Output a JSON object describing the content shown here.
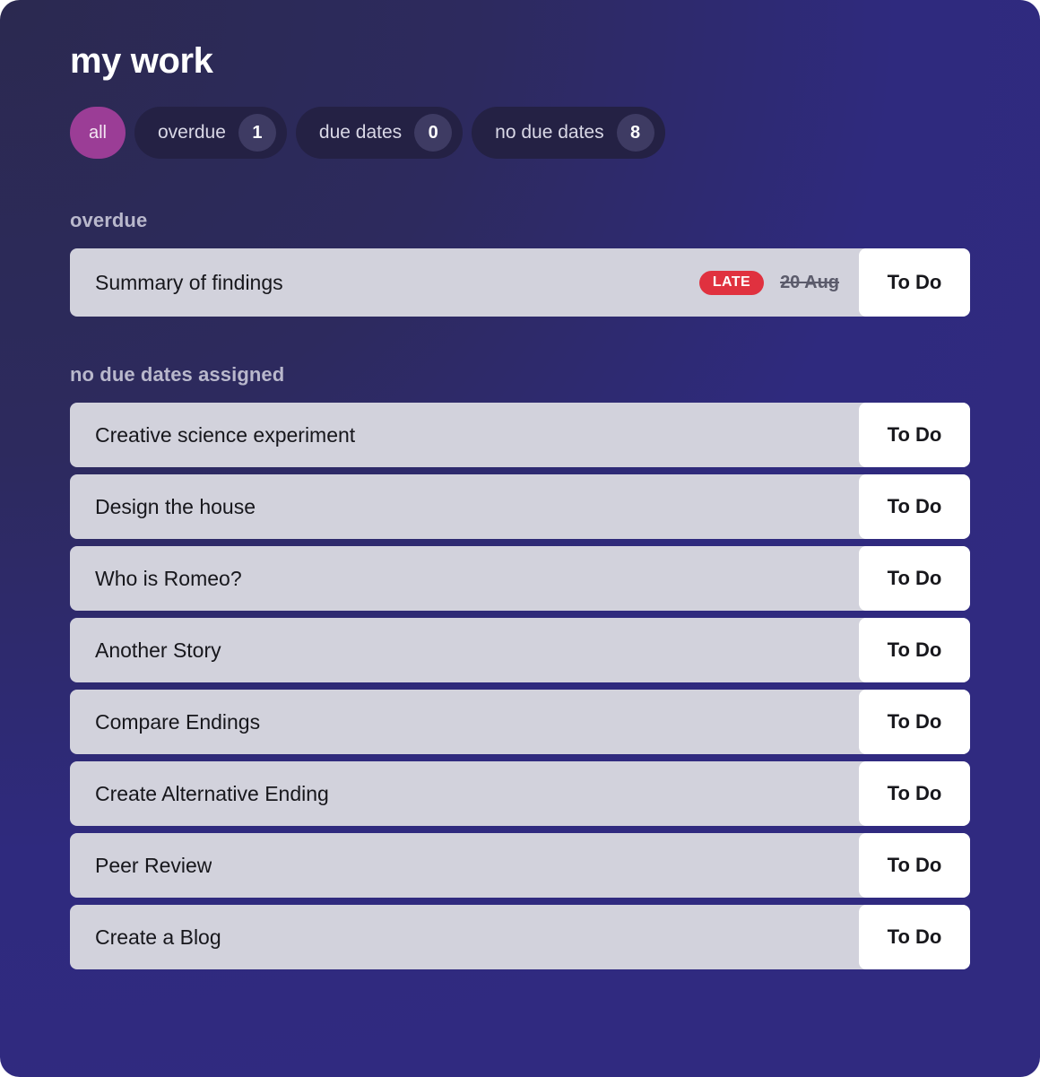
{
  "header": {
    "title": "my work"
  },
  "filters": [
    {
      "label": "all",
      "count": null,
      "active": true,
      "type": "all"
    },
    {
      "label": "overdue",
      "count": "1",
      "active": false,
      "type": "count"
    },
    {
      "label": "due dates",
      "count": "0",
      "active": false,
      "type": "count"
    },
    {
      "label": "no due dates",
      "count": "8",
      "active": false,
      "type": "count"
    }
  ],
  "sections": {
    "overdue": {
      "heading": "overdue",
      "tasks": [
        {
          "title": "Summary of findings",
          "badge": "LATE",
          "due_date": "20 Aug",
          "status": "To Do"
        }
      ]
    },
    "no_due_dates": {
      "heading": "no due dates assigned",
      "tasks": [
        {
          "title": "Creative science experiment",
          "status": "To Do"
        },
        {
          "title": "Design the house",
          "status": "To Do"
        },
        {
          "title": "Who is Romeo?",
          "status": "To Do"
        },
        {
          "title": "Another Story",
          "status": "To Do"
        },
        {
          "title": "Compare Endings",
          "status": "To Do"
        },
        {
          "title": "Create Alternative Ending",
          "status": "To Do"
        },
        {
          "title": "Peer Review",
          "status": "To Do"
        },
        {
          "title": "Create a Blog",
          "status": "To Do"
        }
      ]
    }
  },
  "colors": {
    "accent_active_pill": "#9b3d96",
    "late_badge": "#e0313f",
    "card_background": "#d2d2dc",
    "status_background": "#ffffff",
    "panel_gradient_start": "#2b2950",
    "panel_gradient_end": "#302a80"
  }
}
